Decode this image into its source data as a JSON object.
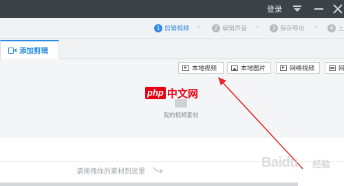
{
  "titlebar": {
    "login": "登录"
  },
  "steps": [
    {
      "num": "1",
      "label": "剪辑视频",
      "active": true
    },
    {
      "num": "2",
      "label": "编辑声音",
      "active": false
    },
    {
      "num": "3",
      "label": "保存导出",
      "active": false
    },
    {
      "num": "4",
      "label": "上",
      "active": false
    }
  ],
  "tab": {
    "label": "添加剪辑"
  },
  "sources": [
    {
      "label": "本地视频",
      "icon": "video-icon"
    },
    {
      "label": "本地图片",
      "icon": "image-icon"
    },
    {
      "label": "网络视频",
      "icon": "network-video-icon"
    },
    {
      "label": "网",
      "icon": "network-image-icon"
    }
  ],
  "watermark": {
    "php": "php",
    "zh": "中文网"
  },
  "panel": {
    "empty_caption": "我的视频素材"
  },
  "timeline": {
    "hint": "请拖拽你的素材到这里"
  },
  "baidu_mark": {
    "text": "Baidu",
    "suffix": "经验"
  },
  "colors": {
    "accent": "#2d8ce0",
    "annotation": "#e5262a",
    "titlebar": "#3c4248"
  }
}
